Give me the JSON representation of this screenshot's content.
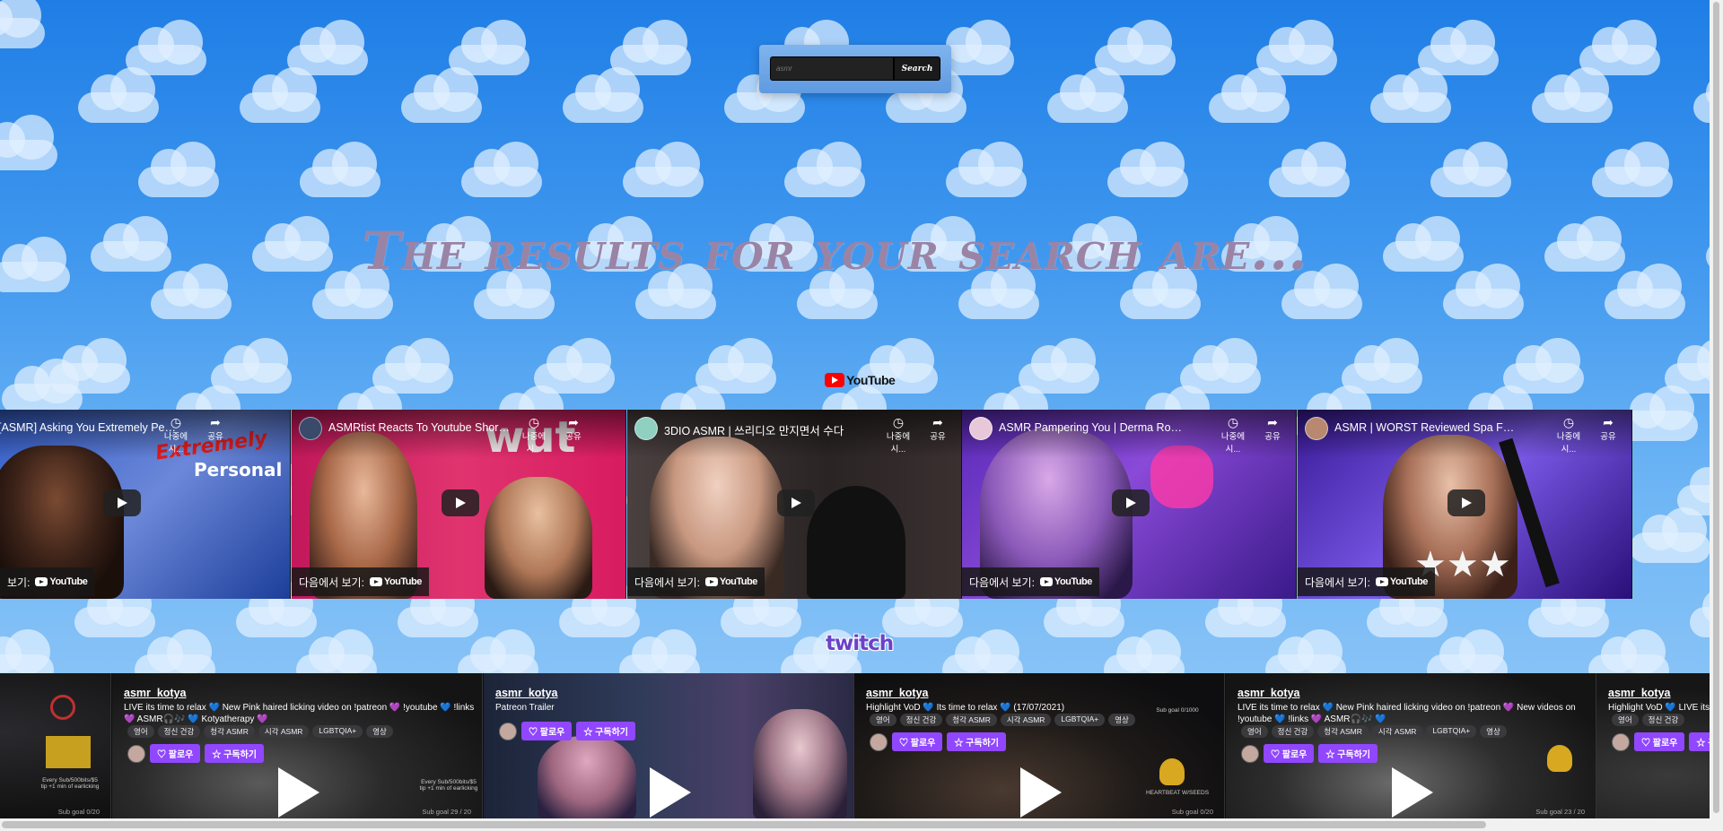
{
  "search": {
    "placeholder": "asmr",
    "button_label": "Search"
  },
  "headline": "The results for your search are...",
  "youtube": {
    "logo_text": "YouTube",
    "later_label": "나중에 시...",
    "share_label": "공유",
    "watch_on_label": "다음에서 보기:",
    "videos": [
      {
        "title": "[ASMR] Asking You Extremely Person...",
        "thumb_text": "Extremely Personal",
        "watch_on_label": "보기:"
      },
      {
        "title": "ASMRtist Reacts To Youtube Shorts A...",
        "thumb_text": "wut"
      },
      {
        "title": "3DIO ASMR | 쓰리디오 만지면서 수다",
        "thumb_text": ""
      },
      {
        "title": "ASMR Pampering You | Derma Rolling ...",
        "thumb_text": ""
      },
      {
        "title": "ASMR | WORST Reviewed Spa Facial",
        "thumb_text": ""
      }
    ]
  },
  "twitch": {
    "logo_text": "twitch",
    "follow_label": "팔로우",
    "subscribe_label": "구독하기",
    "streams": [
      {
        "channel": "asmr_kotya",
        "description": "LIVE its time to relax 💙 New Pink haired licking video on !patreon 💜 !youtube 💙 !links 💜 ASMR🎧🎶 💙 Kotyatherapy 💜",
        "tags": [
          "영어",
          "정신 건강",
          "청각 ASMR",
          "시각 ASMR",
          "LGBTQIA+",
          "영상"
        ],
        "sub_goal": "Sub goal 29 / 20"
      },
      {
        "channel": "asmr_kotya",
        "description": "Patreon Trailer",
        "tags": [],
        "sub_goal": ""
      },
      {
        "channel": "asmr_kotya",
        "description": "Highlight VoD 💙 Its time to relax 💙 (17/07/2021)",
        "tags": [
          "영어",
          "정신 건강",
          "청각 ASMR",
          "시각 ASMR",
          "LGBTQIA+",
          "영상"
        ],
        "sub_goal": "Sub goal 0/20"
      },
      {
        "channel": "asmr_kotya",
        "description": "LIVE its time to relax 💙 New Pink haired licking video on !patreon 💜 New videos on !youtube 💙 !links 💜 ASMR🎧🎶 💙",
        "tags": [
          "영어",
          "정신 건강",
          "청각 ASMR",
          "시각 ASMR",
          "LGBTQIA+",
          "영상"
        ],
        "sub_goal": "Sub goal 23 / 20"
      },
      {
        "channel": "asmr_kotya",
        "description": "Highlight VoD 💙 LIVE its ti...",
        "tags": [
          "영어",
          "정신 건강"
        ],
        "sub_goal": ""
      }
    ],
    "left_partial_sub_goal": "Sub goal 0/20",
    "overlay_caption": "Every Sub/500bits/$5 tip +1 min of earlicking"
  }
}
